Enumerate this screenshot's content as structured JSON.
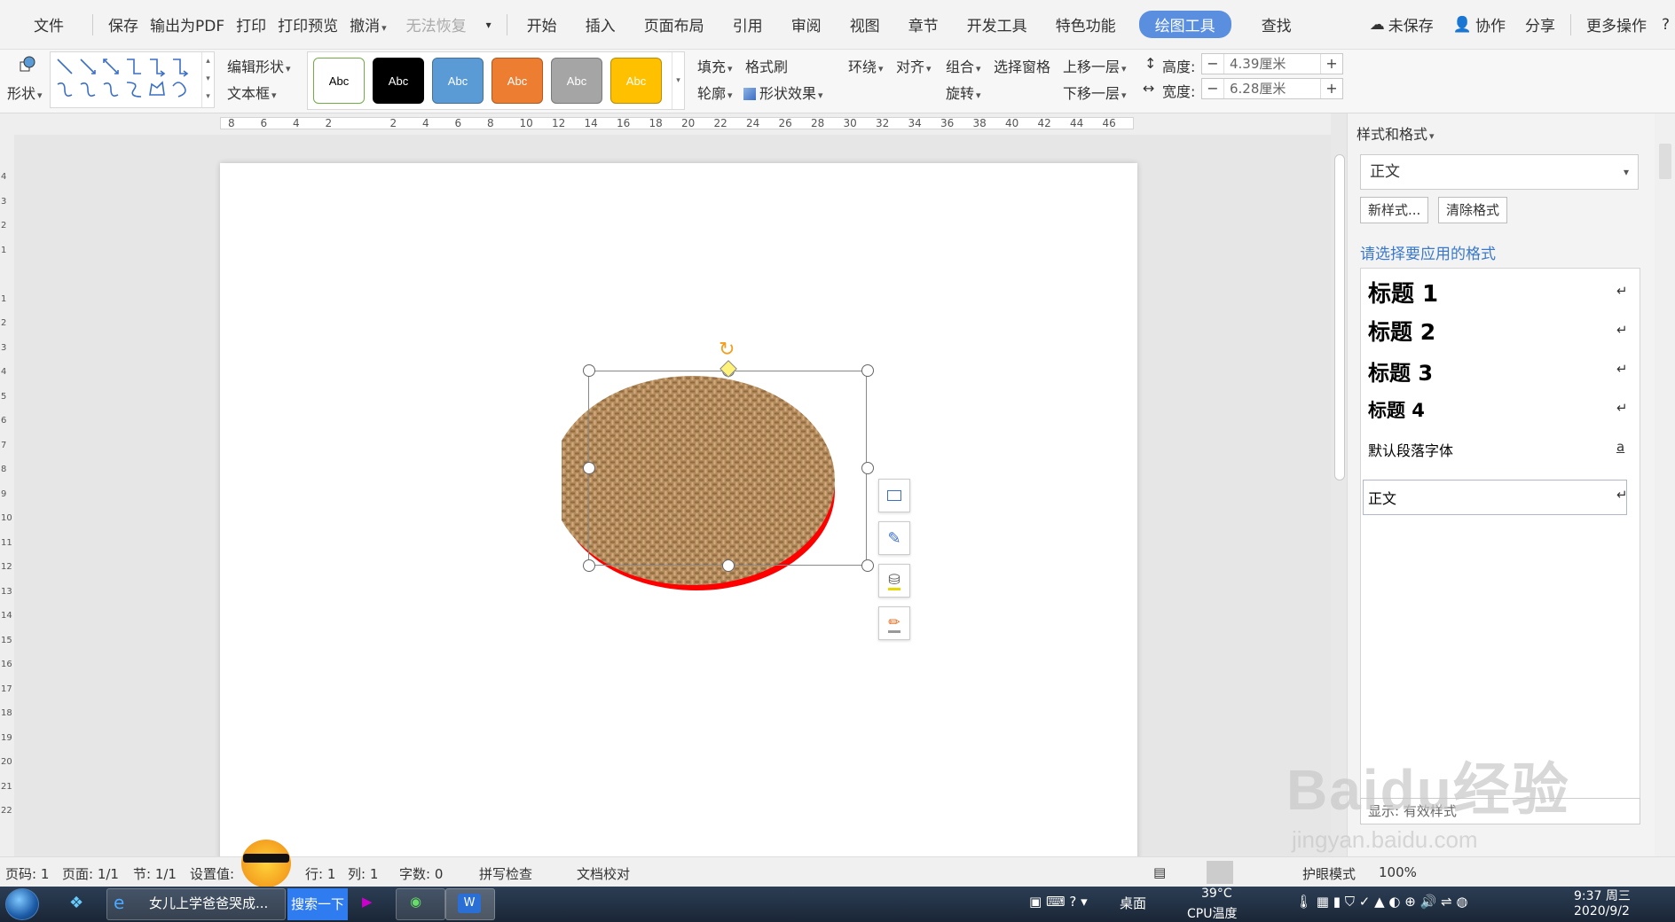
{
  "menu": {
    "file": "文件",
    "save": "保存",
    "export_pdf": "输出为PDF",
    "print": "打印",
    "print_preview": "打印预览",
    "undo": "撤消",
    "redo": "无法恢复",
    "tabs": [
      "开始",
      "插入",
      "页面布局",
      "引用",
      "审阅",
      "视图",
      "章节",
      "开发工具",
      "特色功能"
    ],
    "active_tab": "绘图工具",
    "find": "查找",
    "unsaved": "未保存",
    "collab": "协作",
    "share": "分享",
    "more": "更多操作"
  },
  "ribbon": {
    "shape": "形状",
    "edit_shape": "编辑形状",
    "text_box": "文本框",
    "style_swatches": [
      {
        "label": "Abc",
        "bg": "#ffffff",
        "fg": "#000000",
        "border": "#70ad47"
      },
      {
        "label": "Abc",
        "bg": "#000000",
        "fg": "#ffffff",
        "border": "#000000"
      },
      {
        "label": "Abc",
        "bg": "#5b9bd5",
        "fg": "#ffffff",
        "border": "#41719c"
      },
      {
        "label": "Abc",
        "bg": "#ed7d31",
        "fg": "#ffffff",
        "border": "#ae5a21"
      },
      {
        "label": "Abc",
        "bg": "#a5a5a5",
        "fg": "#ffffff",
        "border": "#787878"
      },
      {
        "label": "Abc",
        "bg": "#ffc000",
        "fg": "#ffffff",
        "border": "#bc8c00"
      }
    ],
    "fill": "填充",
    "format_painter": "格式刷",
    "outline": "轮廓",
    "shape_effect": "形状效果",
    "wrap": "环绕",
    "align": "对齐",
    "group": "组合",
    "selection_pane": "选择窗格",
    "bring_forward": "上移一层",
    "rotate": "旋转",
    "send_backward": "下移一层",
    "height_label": "高度:",
    "height_value": "4.39厘米",
    "width_label": "宽度:",
    "width_value": "6.28厘米"
  },
  "ruler": {
    "h_ticks": [
      "8",
      "6",
      "4",
      "2",
      "",
      "2",
      "4",
      "6",
      "8",
      "10",
      "12",
      "14",
      "16",
      "18",
      "20",
      "22",
      "24",
      "26",
      "28",
      "30",
      "32",
      "34",
      "36",
      "38",
      "40",
      "42",
      "44",
      "46"
    ],
    "v_ticks": [
      "4",
      "3",
      "2",
      "1",
      "",
      "1",
      "2",
      "3",
      "4",
      "5",
      "6",
      "7",
      "8",
      "9",
      "10",
      "11",
      "12",
      "13",
      "14",
      "15",
      "16",
      "17",
      "18",
      "19",
      "20",
      "21",
      "22"
    ]
  },
  "panel": {
    "title": "样式和格式",
    "current_style": "正文",
    "new_style": "新样式...",
    "clear_format": "清除格式",
    "hint": "请选择要应用的格式",
    "items": [
      {
        "label": "标题  1"
      },
      {
        "label": "标题  2"
      },
      {
        "label": "标题  3"
      },
      {
        "label": "标题  4"
      },
      {
        "label": "默认段落字体"
      },
      {
        "label": "正文"
      }
    ],
    "enter_symbol": "↵",
    "font_symbol": "a",
    "show_label": "显示:",
    "show_value": "有效样式"
  },
  "status": {
    "page_num": "页码: 1",
    "pages": "页面: 1/1",
    "section": "节: 1/1",
    "setting": "设置值:",
    "row": "行: 1",
    "col": "列: 1",
    "word_count": "字数: 0",
    "spell_check": "拼写检查",
    "doc_proof": "文档校对",
    "eye_mode": "护眼模式",
    "zoom": "100%"
  },
  "taskbar": {
    "ie_title": "女儿上学爸爸哭成...",
    "search_btn": "搜索一下",
    "desktop": "桌面",
    "temp": "39°C",
    "cpu": "CPU温度",
    "time": "9:37 周三",
    "date": "2020/9/2"
  },
  "watermark": {
    "brand": "Baidu经验",
    "url": "jingyan.baidu.com"
  },
  "colors": {
    "accent": "#5a8fe0",
    "shape_fill": "#b38a5c",
    "shape_shadow": "#ff0000"
  }
}
